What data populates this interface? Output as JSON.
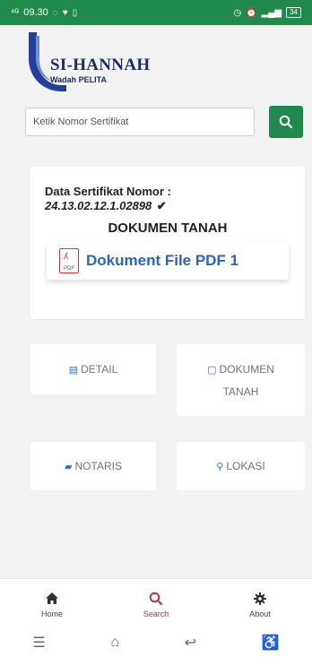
{
  "status_bar": {
    "time": "09.30",
    "left_icons": [
      "network-icon",
      "whatsapp-icon",
      "notification-icon",
      "sim-icon"
    ],
    "right_icons": [
      "clock-icon",
      "alarm-icon",
      "signal-icon"
    ],
    "battery": "34"
  },
  "logo": {
    "title": "SI-HANNAH",
    "subtitle": "Wadah PELITA"
  },
  "search": {
    "placeholder": "Ketik Nomor Sertifikat",
    "value": ""
  },
  "certificate": {
    "label": "Data Sertifikat Nomor :",
    "number": "24.13.02.12.1.02898",
    "check": "✔",
    "heading": "DOKUMEN TANAH",
    "pdf_link": "Dokument File PDF 1",
    "pdf_icon_text": "PDF"
  },
  "menu": {
    "detail": "DETAIL",
    "dokumen_line1": "DOKUMEN",
    "dokumen_line2": "TANAH",
    "notaris": "NOTARIS",
    "lokasi": "LOKASI"
  },
  "bottom_nav": {
    "home": "Home",
    "search": "Search",
    "about": "About"
  },
  "colors": {
    "status_bar": "#1f8a4c",
    "search_button": "#1f8a4c",
    "link_blue": "#2a66b8",
    "active_nav": "#c0304a"
  }
}
